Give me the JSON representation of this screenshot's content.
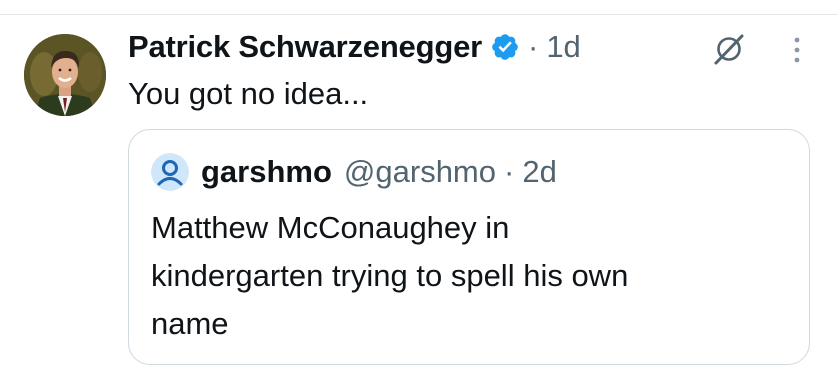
{
  "tweet": {
    "author_name": "Patrick Schwarzenegger",
    "time_separator": "·",
    "time": "1d",
    "text": "You got no idea...",
    "avatar_icon": "profile-photo",
    "verified_icon": "verified-badge-icon",
    "grok_icon": "grok-icon",
    "more_icon": "more-options-icon"
  },
  "quote": {
    "author_name": "garshmo",
    "handle": "@garshmo",
    "time_separator": "·",
    "time": "2d",
    "avatar_icon": "default-avatar-icon",
    "text_lines": [
      "Matthew McConaughey in",
      "kindergarten trying to spell his own",
      "name"
    ]
  },
  "colors": {
    "verified_blue": "#1d9bf0",
    "secondary_text": "#536471",
    "primary_text": "#0f1419",
    "border": "#cfd9de"
  }
}
